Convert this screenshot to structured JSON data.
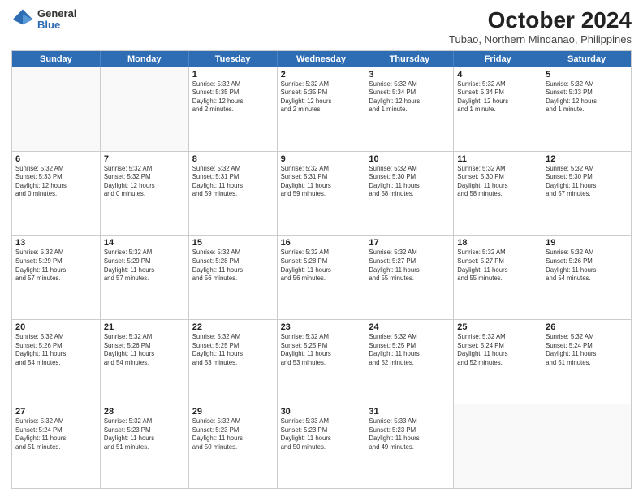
{
  "logo": {
    "general": "General",
    "blue": "Blue"
  },
  "title": {
    "month": "October 2024",
    "location": "Tubao, Northern Mindanao, Philippines"
  },
  "days": [
    "Sunday",
    "Monday",
    "Tuesday",
    "Wednesday",
    "Thursday",
    "Friday",
    "Saturday"
  ],
  "weeks": [
    [
      {
        "day": "",
        "info": ""
      },
      {
        "day": "",
        "info": ""
      },
      {
        "day": "1",
        "info": "Sunrise: 5:32 AM\nSunset: 5:35 PM\nDaylight: 12 hours\nand 2 minutes."
      },
      {
        "day": "2",
        "info": "Sunrise: 5:32 AM\nSunset: 5:35 PM\nDaylight: 12 hours\nand 2 minutes."
      },
      {
        "day": "3",
        "info": "Sunrise: 5:32 AM\nSunset: 5:34 PM\nDaylight: 12 hours\nand 1 minute."
      },
      {
        "day": "4",
        "info": "Sunrise: 5:32 AM\nSunset: 5:34 PM\nDaylight: 12 hours\nand 1 minute."
      },
      {
        "day": "5",
        "info": "Sunrise: 5:32 AM\nSunset: 5:33 PM\nDaylight: 12 hours\nand 1 minute."
      }
    ],
    [
      {
        "day": "6",
        "info": "Sunrise: 5:32 AM\nSunset: 5:33 PM\nDaylight: 12 hours\nand 0 minutes."
      },
      {
        "day": "7",
        "info": "Sunrise: 5:32 AM\nSunset: 5:32 PM\nDaylight: 12 hours\nand 0 minutes."
      },
      {
        "day": "8",
        "info": "Sunrise: 5:32 AM\nSunset: 5:31 PM\nDaylight: 11 hours\nand 59 minutes."
      },
      {
        "day": "9",
        "info": "Sunrise: 5:32 AM\nSunset: 5:31 PM\nDaylight: 11 hours\nand 59 minutes."
      },
      {
        "day": "10",
        "info": "Sunrise: 5:32 AM\nSunset: 5:30 PM\nDaylight: 11 hours\nand 58 minutes."
      },
      {
        "day": "11",
        "info": "Sunrise: 5:32 AM\nSunset: 5:30 PM\nDaylight: 11 hours\nand 58 minutes."
      },
      {
        "day": "12",
        "info": "Sunrise: 5:32 AM\nSunset: 5:30 PM\nDaylight: 11 hours\nand 57 minutes."
      }
    ],
    [
      {
        "day": "13",
        "info": "Sunrise: 5:32 AM\nSunset: 5:29 PM\nDaylight: 11 hours\nand 57 minutes."
      },
      {
        "day": "14",
        "info": "Sunrise: 5:32 AM\nSunset: 5:29 PM\nDaylight: 11 hours\nand 57 minutes."
      },
      {
        "day": "15",
        "info": "Sunrise: 5:32 AM\nSunset: 5:28 PM\nDaylight: 11 hours\nand 56 minutes."
      },
      {
        "day": "16",
        "info": "Sunrise: 5:32 AM\nSunset: 5:28 PM\nDaylight: 11 hours\nand 56 minutes."
      },
      {
        "day": "17",
        "info": "Sunrise: 5:32 AM\nSunset: 5:27 PM\nDaylight: 11 hours\nand 55 minutes."
      },
      {
        "day": "18",
        "info": "Sunrise: 5:32 AM\nSunset: 5:27 PM\nDaylight: 11 hours\nand 55 minutes."
      },
      {
        "day": "19",
        "info": "Sunrise: 5:32 AM\nSunset: 5:26 PM\nDaylight: 11 hours\nand 54 minutes."
      }
    ],
    [
      {
        "day": "20",
        "info": "Sunrise: 5:32 AM\nSunset: 5:26 PM\nDaylight: 11 hours\nand 54 minutes."
      },
      {
        "day": "21",
        "info": "Sunrise: 5:32 AM\nSunset: 5:26 PM\nDaylight: 11 hours\nand 54 minutes."
      },
      {
        "day": "22",
        "info": "Sunrise: 5:32 AM\nSunset: 5:25 PM\nDaylight: 11 hours\nand 53 minutes."
      },
      {
        "day": "23",
        "info": "Sunrise: 5:32 AM\nSunset: 5:25 PM\nDaylight: 11 hours\nand 53 minutes."
      },
      {
        "day": "24",
        "info": "Sunrise: 5:32 AM\nSunset: 5:25 PM\nDaylight: 11 hours\nand 52 minutes."
      },
      {
        "day": "25",
        "info": "Sunrise: 5:32 AM\nSunset: 5:24 PM\nDaylight: 11 hours\nand 52 minutes."
      },
      {
        "day": "26",
        "info": "Sunrise: 5:32 AM\nSunset: 5:24 PM\nDaylight: 11 hours\nand 51 minutes."
      }
    ],
    [
      {
        "day": "27",
        "info": "Sunrise: 5:32 AM\nSunset: 5:24 PM\nDaylight: 11 hours\nand 51 minutes."
      },
      {
        "day": "28",
        "info": "Sunrise: 5:32 AM\nSunset: 5:23 PM\nDaylight: 11 hours\nand 51 minutes."
      },
      {
        "day": "29",
        "info": "Sunrise: 5:32 AM\nSunset: 5:23 PM\nDaylight: 11 hours\nand 50 minutes."
      },
      {
        "day": "30",
        "info": "Sunrise: 5:33 AM\nSunset: 5:23 PM\nDaylight: 11 hours\nand 50 minutes."
      },
      {
        "day": "31",
        "info": "Sunrise: 5:33 AM\nSunset: 5:23 PM\nDaylight: 11 hours\nand 49 minutes."
      },
      {
        "day": "",
        "info": ""
      },
      {
        "day": "",
        "info": ""
      }
    ]
  ]
}
